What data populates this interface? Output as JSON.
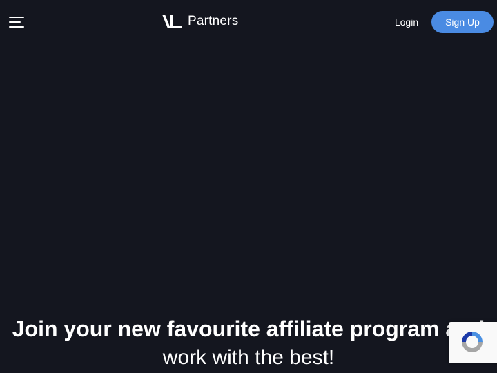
{
  "header": {
    "menu_icon": "hamburger-menu-icon",
    "logo_text": "Partners",
    "login_label": "Login",
    "signup_label": "Sign Up"
  },
  "hero": {
    "title_line1": "Join your new favourite affiliate program and",
    "title_line2": "work with the best!"
  },
  "recaptcha": {
    "icon": "recaptcha-icon"
  },
  "colors": {
    "background": "#14161f",
    "accent": "#4a8be3",
    "text": "#ffffff"
  }
}
